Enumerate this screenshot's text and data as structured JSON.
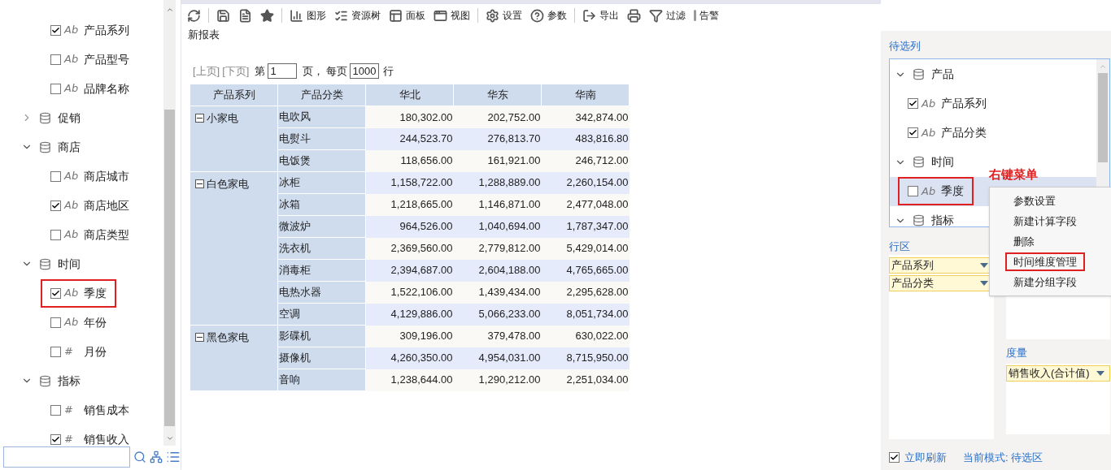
{
  "left_tree": [
    {
      "kind": "field",
      "label": "产品系列",
      "type_icon": "Ab",
      "checked": true,
      "highlighted": false
    },
    {
      "kind": "field",
      "label": "产品型号",
      "type_icon": "Ab",
      "checked": false,
      "highlighted": false
    },
    {
      "kind": "field",
      "label": "品牌名称",
      "type_icon": "Ab",
      "checked": false,
      "highlighted": false
    },
    {
      "kind": "group",
      "label": "促销",
      "expanded": false
    },
    {
      "kind": "group",
      "label": "商店",
      "expanded": true,
      "children": [
        {
          "kind": "field",
          "label": "商店城市",
          "type_icon": "Ab",
          "checked": false,
          "highlighted": false
        },
        {
          "kind": "field",
          "label": "商店地区",
          "type_icon": "Ab",
          "checked": true,
          "highlighted": false
        },
        {
          "kind": "field",
          "label": "商店类型",
          "type_icon": "Ab",
          "checked": false,
          "highlighted": false
        }
      ]
    },
    {
      "kind": "group",
      "label": "时间",
      "expanded": true,
      "children": [
        {
          "kind": "field",
          "label": "季度",
          "type_icon": "Ab",
          "checked": true,
          "highlighted": true
        },
        {
          "kind": "field",
          "label": "年份",
          "type_icon": "Ab",
          "checked": false,
          "highlighted": false
        },
        {
          "kind": "field",
          "label": "月份",
          "type_icon": "#",
          "checked": false,
          "highlighted": false
        }
      ]
    },
    {
      "kind": "group",
      "label": "指标",
      "expanded": true,
      "children": [
        {
          "kind": "field",
          "label": "销售成本",
          "type_icon": "#",
          "checked": false,
          "highlighted": false
        },
        {
          "kind": "field",
          "label": "销售收入",
          "type_icon": "#",
          "checked": true,
          "highlighted": false
        }
      ]
    }
  ],
  "toolbar": [
    {
      "kind": "refresh"
    },
    {
      "kind": "separator"
    },
    {
      "kind": "save"
    },
    {
      "kind": "save-as"
    },
    {
      "kind": "favorite"
    },
    {
      "kind": "separator"
    },
    {
      "kind": "chart",
      "label": "图形"
    },
    {
      "kind": "tree",
      "label": "资源树"
    },
    {
      "kind": "panel",
      "label": "面板"
    },
    {
      "kind": "view",
      "label": "视图"
    },
    {
      "kind": "separator"
    },
    {
      "kind": "settings",
      "label": "设置"
    },
    {
      "kind": "help",
      "label": "参数"
    },
    {
      "kind": "separator"
    },
    {
      "kind": "export",
      "label": "导出"
    },
    {
      "kind": "print"
    },
    {
      "kind": "filter",
      "label": "过滤"
    },
    {
      "kind": "alert",
      "label": "告警"
    }
  ],
  "report_title": "新报表",
  "pager": {
    "prev": "[上页]",
    "next": "[下页]",
    "page_prefix": "第",
    "page": "1",
    "page_suffix": "页，",
    "per_page_prefix": "每页",
    "per_page": "1000",
    "per_page_suffix": "行"
  },
  "table": {
    "columns": [
      "产品系列",
      "产品分类",
      "华北",
      "华东",
      "华南"
    ],
    "groups": [
      {
        "label": "小家电",
        "expanded": true,
        "rows": [
          {
            "category": "电吹风",
            "values": [
              "180,302.00",
              "202,752.00",
              "342,874.00"
            ]
          },
          {
            "category": "电熨斗",
            "values": [
              "244,523.70",
              "276,813.70",
              "483,816.80"
            ]
          },
          {
            "category": "电饭煲",
            "values": [
              "118,656.00",
              "161,921.00",
              "246,712.00"
            ]
          }
        ]
      },
      {
        "label": "白色家电",
        "expanded": true,
        "rows": [
          {
            "category": "冰柜",
            "values": [
              "1,158,722.00",
              "1,288,889.00",
              "2,260,154.00"
            ]
          },
          {
            "category": "冰箱",
            "values": [
              "1,218,665.00",
              "1,146,871.00",
              "2,477,048.00"
            ]
          },
          {
            "category": "微波炉",
            "values": [
              "964,526.00",
              "1,040,694.00",
              "1,787,347.00"
            ]
          },
          {
            "category": "洗衣机",
            "values": [
              "2,369,560.00",
              "2,779,812.00",
              "5,429,014.00"
            ]
          },
          {
            "category": "消毒柜",
            "values": [
              "2,394,687.00",
              "2,604,188.00",
              "4,765,665.00"
            ]
          },
          {
            "category": "电热水器",
            "values": [
              "1,522,106.00",
              "1,439,434.00",
              "2,295,628.00"
            ]
          },
          {
            "category": "空调",
            "values": [
              "4,129,886.00",
              "5,066,233.00",
              "8,051,734.00"
            ]
          }
        ]
      },
      {
        "label": "黑色家电",
        "expanded": true,
        "rows": [
          {
            "category": "影碟机",
            "values": [
              "309,196.00",
              "379,478.00",
              "630,022.00"
            ]
          },
          {
            "category": "摄像机",
            "values": [
              "4,260,350.00",
              "4,954,031.00",
              "8,715,950.00"
            ]
          },
          {
            "category": "音响",
            "values": [
              "1,238,644.00",
              "1,290,212.00",
              "2,251,034.00"
            ]
          }
        ]
      }
    ]
  },
  "right_panel": {
    "candidates_title": "待选列",
    "tree": [
      {
        "kind": "group",
        "label": "产品",
        "expanded": true,
        "children": [
          {
            "kind": "field",
            "label": "产品系列",
            "type_icon": "Ab",
            "checked": true,
            "selected": false,
            "highlighted": false
          },
          {
            "kind": "field",
            "label": "产品分类",
            "type_icon": "Ab",
            "checked": true,
            "selected": false,
            "highlighted": false
          }
        ]
      },
      {
        "kind": "group",
        "label": "时间",
        "expanded": true,
        "children": [
          {
            "kind": "field",
            "label": "季度",
            "type_icon": "Ab",
            "checked": false,
            "selected": true,
            "highlighted": true
          }
        ]
      },
      {
        "kind": "group",
        "label": "指标",
        "expanded": true
      }
    ],
    "annotation": "右键菜单",
    "context_menu": [
      {
        "label": "参数设置",
        "highlighted": false
      },
      {
        "label": "新建计算字段",
        "highlighted": false
      },
      {
        "label": "删除",
        "highlighted": false
      },
      {
        "label": "时间维度管理",
        "highlighted": true
      },
      {
        "label": "新建分组字段",
        "highlighted": false
      }
    ],
    "row_area": {
      "title": "行区",
      "fields": [
        "产品系列",
        "产品分类"
      ]
    },
    "measure_area": {
      "title": "度量",
      "fields": [
        "销售收入(合计值)"
      ]
    },
    "auto_refresh": {
      "label": "立即刷新",
      "checked": true
    },
    "mode": "当前模式: 待选区"
  }
}
